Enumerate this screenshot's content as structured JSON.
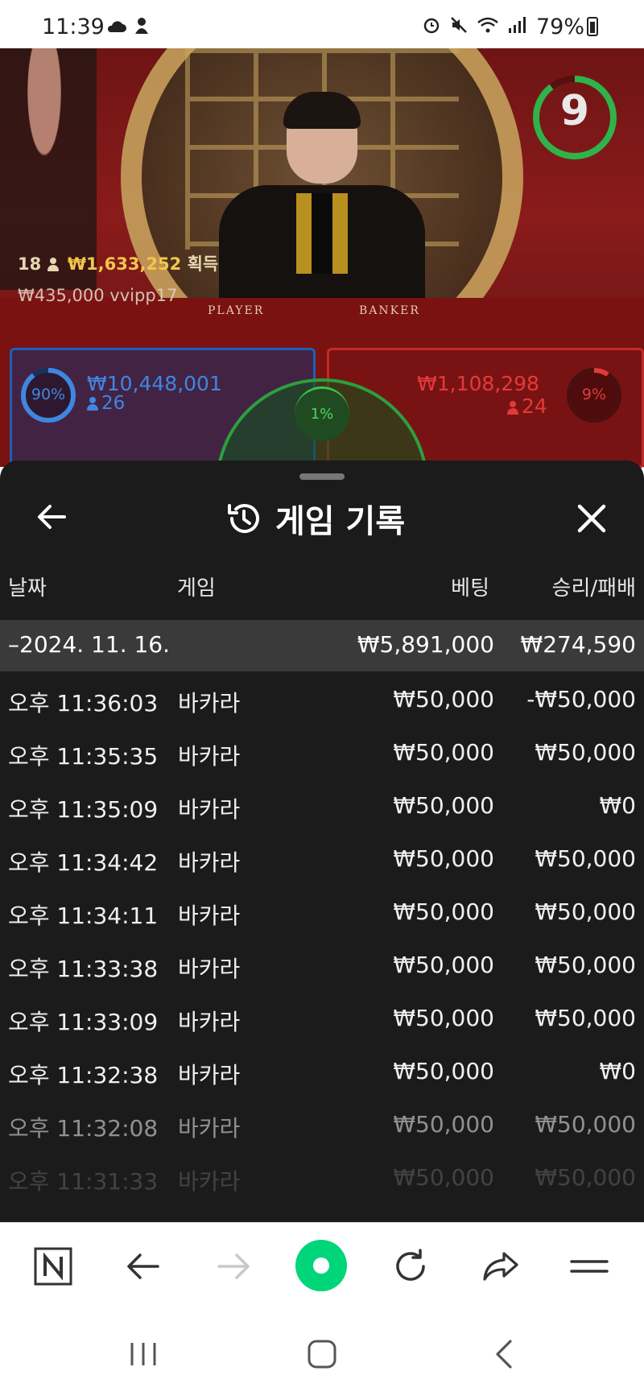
{
  "status_bar": {
    "time": "11:39",
    "battery": "79%"
  },
  "stream": {
    "countdown": "9",
    "table_labels": {
      "player": "PLAYER",
      "banker": "BANKER"
    },
    "winner_banner": {
      "count": "18",
      "amount": "₩1,633,252",
      "suffix": "획득"
    },
    "recent_bet": {
      "amount": "₩435,000",
      "user": "vvipp17"
    },
    "player": {
      "percent": "90%",
      "amount": "₩10,448,001",
      "players": "26",
      "color": "#3f86e0"
    },
    "banker": {
      "percent": "9%",
      "amount": "₩1,108,298",
      "players": "24",
      "color": "#e23a3a"
    },
    "tie": {
      "percent": "1%",
      "color": "#4fd35c"
    }
  },
  "history_sheet": {
    "title": "게임 기록",
    "icons": {
      "back": "arrow-left-icon",
      "history": "history-icon",
      "close": "close-icon"
    },
    "columns": {
      "date": "날짜",
      "game": "게임",
      "bet": "베팅",
      "win_loss": "승리/패배"
    },
    "group": {
      "toggle": "–",
      "date": "2024. 11. 16.",
      "bet_total": "₩5,891,000",
      "win_loss_total": "₩274,590"
    },
    "rows": [
      {
        "time": "오후 11:36:03",
        "game": "바카라",
        "bet": "₩50,000",
        "win_loss": "-₩50,000"
      },
      {
        "time": "오후 11:35:35",
        "game": "바카라",
        "bet": "₩50,000",
        "win_loss": "₩50,000"
      },
      {
        "time": "오후 11:35:09",
        "game": "바카라",
        "bet": "₩50,000",
        "win_loss": "₩0"
      },
      {
        "time": "오후 11:34:42",
        "game": "바카라",
        "bet": "₩50,000",
        "win_loss": "₩50,000"
      },
      {
        "time": "오후 11:34:11",
        "game": "바카라",
        "bet": "₩50,000",
        "win_loss": "₩50,000"
      },
      {
        "time": "오후 11:33:38",
        "game": "바카라",
        "bet": "₩50,000",
        "win_loss": "₩50,000"
      },
      {
        "time": "오후 11:33:09",
        "game": "바카라",
        "bet": "₩50,000",
        "win_loss": "₩50,000"
      },
      {
        "time": "오후 11:32:38",
        "game": "바카라",
        "bet": "₩50,000",
        "win_loss": "₩0"
      },
      {
        "time": "오후 11:32:08",
        "game": "바카라",
        "bet": "₩50,000",
        "win_loss": "₩50,000"
      },
      {
        "time": "오후 11:31:33",
        "game": "바카라",
        "bet": "₩50,000",
        "win_loss": "₩50,000"
      }
    ]
  },
  "browser_toolbar": {
    "accent": "#00d57a",
    "icons": [
      "naver-n-icon",
      "back-arrow-icon",
      "forward-arrow-icon",
      "green-dot-icon",
      "refresh-icon",
      "share-icon",
      "menu-icon"
    ]
  },
  "system_nav": {
    "icons": [
      "recent-apps-icon",
      "home-icon",
      "back-icon"
    ]
  }
}
